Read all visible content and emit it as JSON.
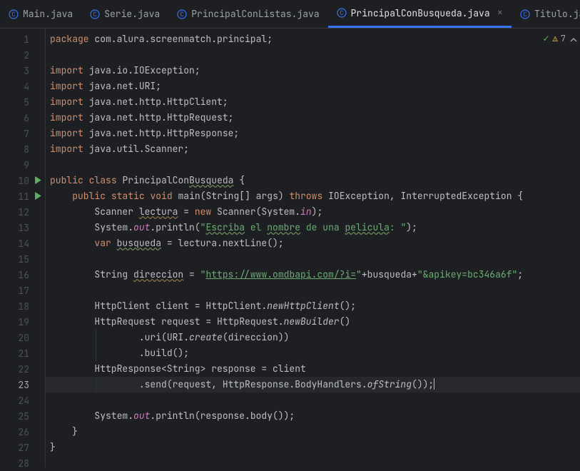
{
  "tabs": {
    "items": [
      {
        "label": "Main.java",
        "active": false
      },
      {
        "label": "Serie.java",
        "active": false
      },
      {
        "label": "PrincipalConListas.java",
        "active": false
      },
      {
        "label": "PrincipalConBusqueda.java",
        "active": true
      },
      {
        "label": "Titulo.jav",
        "active": false
      }
    ]
  },
  "inspection": {
    "count": "7"
  },
  "code": {
    "line1_kw": "package",
    "line1_rest": " com.alura.screenmatch.principal;",
    "line3_kw": "import",
    "line3_rest": " java.io.IOException;",
    "line4_kw": "import",
    "line4_rest": " java.net.URI;",
    "line5_kw": "import",
    "line5_rest": " java.net.http.HttpClient;",
    "line6_kw": "import",
    "line6_rest": " java.net.http.HttpRequest;",
    "line7_kw": "import",
    "line7_rest": " java.net.http.HttpResponse;",
    "line8_kw": "import",
    "line8_rest": " java.util.Scanner;",
    "line10_public": "public",
    "line10_class": "class",
    "line10_name": "PrincipalCon",
    "line10_name2": "Busqueda",
    "line10_brace": " {",
    "line11_indent": "    ",
    "line11_public": "public",
    "line11_static": "static",
    "line11_void": "void",
    "line11_main": "main",
    "line11_args": "(String[] args) ",
    "line11_throws": "throws",
    "line11_ex": " IOException, InterruptedException {",
    "line12_indent": "        ",
    "line12_a": "Scanner ",
    "line12_var": "lectura",
    "line12_b": " = ",
    "line12_new": "new",
    "line12_c": " Scanner(System.",
    "line12_in": "in",
    "line12_d": ");",
    "line13_indent": "        ",
    "line13_a": "System.",
    "line13_out": "out",
    "line13_b": ".println(",
    "line13_q1": "\"",
    "line13_s1": "Escriba",
    "line13_s2": " el ",
    "line13_s3": "nombre",
    "line13_s4": " de una ",
    "line13_s5": "pelicula",
    "line13_s6": ": ",
    "line13_q2": "\"",
    "line13_c": ");",
    "line14_indent": "        ",
    "line14_var": "var",
    "line14_a": " ",
    "line14_name": "busqueda",
    "line14_b": " = lectura.nextLine();",
    "line16_indent": "        ",
    "line16_a": "String ",
    "line16_var": "direccion",
    "line16_b": " = ",
    "line16_q1": "\"",
    "line16_url": "https://www.omdbapi.com/?i=",
    "line16_q2": "\"",
    "line16_c": "+busqueda+",
    "line16_q3": "\"",
    "line16_key": "&apikey=bc346a6f",
    "line16_q4": "\"",
    "line16_d": ";",
    "line18_indent": "        ",
    "line18_a": "HttpClient client = HttpClient.",
    "line18_m": "newHttpClient",
    "line18_b": "();",
    "line19_indent": "        ",
    "line19_a": "HttpRequest request = HttpRequest.",
    "line19_m": "newBuilder",
    "line19_b": "()",
    "line20_indent": "                ",
    "line20_a": ".uri(URI.",
    "line20_m": "create",
    "line20_b": "(direccion))",
    "line21_indent": "                ",
    "line21_a": ".build();",
    "line22_indent": "        ",
    "line22_a": "HttpResponse<String> response = client",
    "line23_indent": "                ",
    "line23_a": ".send(request, HttpResponse.BodyHandlers.",
    "line23_m": "ofString",
    "line23_b": "());",
    "line25_indent": "        ",
    "line25_a": "System.",
    "line25_out": "out",
    "line25_b": ".println(response.body());",
    "line26_indent": "    ",
    "line26_a": "}",
    "line27_a": "}"
  },
  "gutter": {
    "l1": "1",
    "l2": "2",
    "l3": "3",
    "l4": "4",
    "l5": "5",
    "l6": "6",
    "l7": "7",
    "l8": "8",
    "l9": "9",
    "l10": "10",
    "l11": "11",
    "l12": "12",
    "l13": "13",
    "l14": "14",
    "l15": "15",
    "l16": "16",
    "l17": "17",
    "l18": "18",
    "l19": "19",
    "l20": "20",
    "l21": "21",
    "l22": "22",
    "l23": "23",
    "l24": "24",
    "l25": "25",
    "l26": "26",
    "l27": "27",
    "l28": "28"
  }
}
